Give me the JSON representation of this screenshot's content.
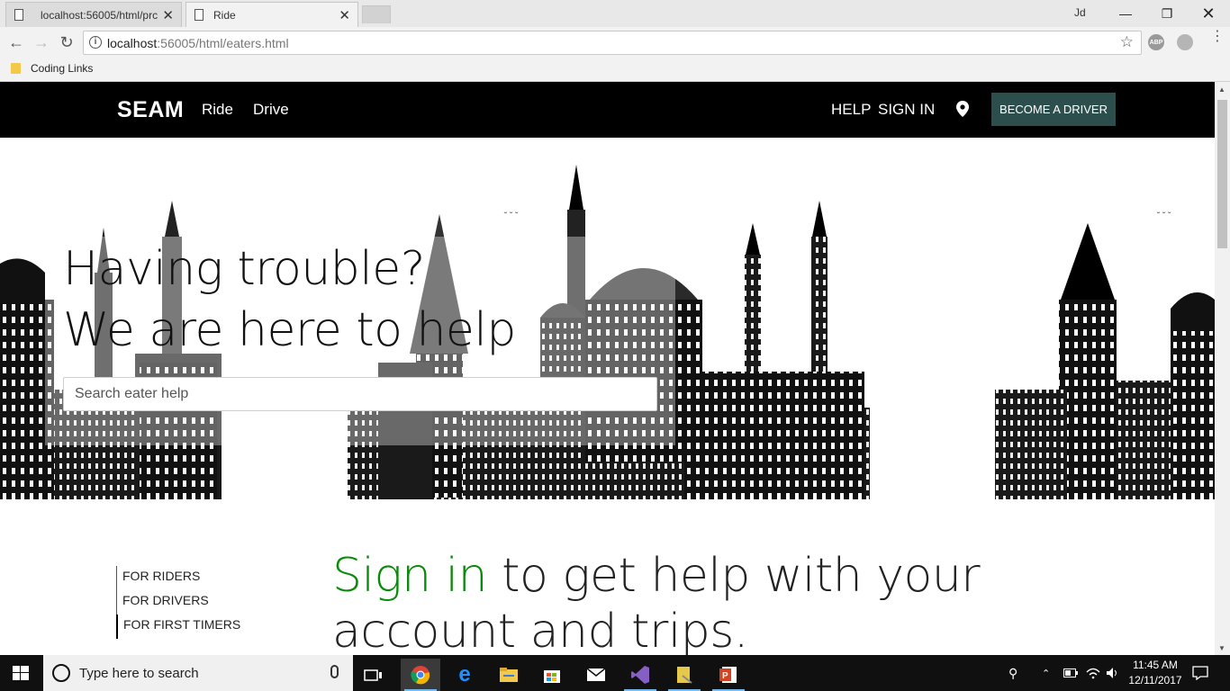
{
  "browser": {
    "tabs": [
      {
        "title": "localhost:56005/html/prc",
        "active": false
      },
      {
        "title": "Ride",
        "active": true
      }
    ],
    "address": {
      "host": "localhost",
      "path": ":56005/html/eaters.html"
    },
    "extension_label": "ABP",
    "bookmark": "Coding Links",
    "profile_label": "Jd"
  },
  "site": {
    "brand": "SEAM",
    "nav_left": [
      "Ride",
      "Drive"
    ],
    "nav_right": [
      "HELP",
      "SIGN IN"
    ],
    "cta": "BECOME A DRIVER",
    "hero": {
      "line1": "Having trouble?",
      "line2": "We are here to help",
      "search_placeholder": "Search eater help"
    },
    "side_links": [
      "FOR RIDERS",
      "FOR DRIVERS",
      "FOR FIRST TIMERS"
    ],
    "signin": {
      "highlight": "Sign in",
      "rest": " to get help with your account and trips."
    }
  },
  "taskbar": {
    "search_placeholder": "Type here to search",
    "time": "11:45 AM",
    "date": "12/11/2017"
  },
  "colors": {
    "nav_bg": "#000000",
    "cta_bg": "#2c4f4e",
    "signin_green": "#0a8a0a"
  }
}
